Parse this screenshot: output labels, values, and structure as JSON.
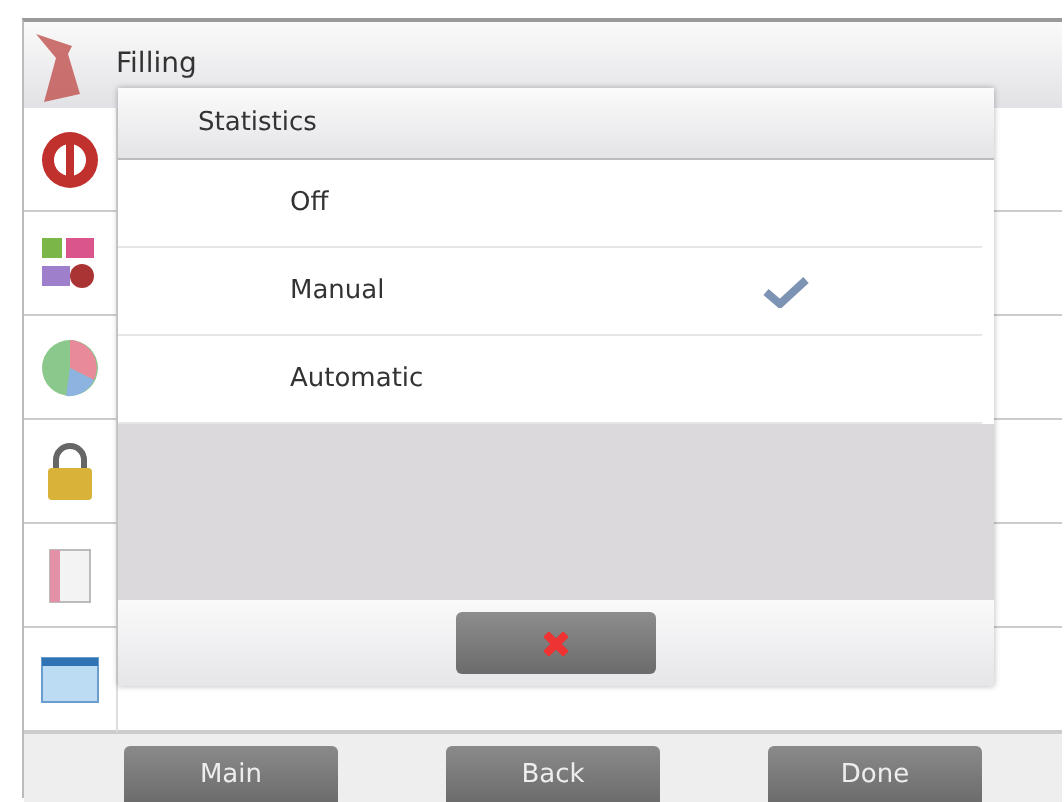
{
  "header": {
    "title": "Filling"
  },
  "sidebar": {
    "items": [
      {
        "kind": "zero"
      },
      {
        "kind": "units"
      },
      {
        "kind": "chart"
      },
      {
        "kind": "lock"
      },
      {
        "kind": "book"
      },
      {
        "kind": "window"
      }
    ]
  },
  "dialog": {
    "title": "Statistics",
    "options": [
      {
        "label": "Off",
        "selected": false
      },
      {
        "label": "Manual",
        "selected": true
      },
      {
        "label": "Automatic",
        "selected": false
      }
    ]
  },
  "buttons": [
    "Main",
    "Back",
    "Done"
  ]
}
